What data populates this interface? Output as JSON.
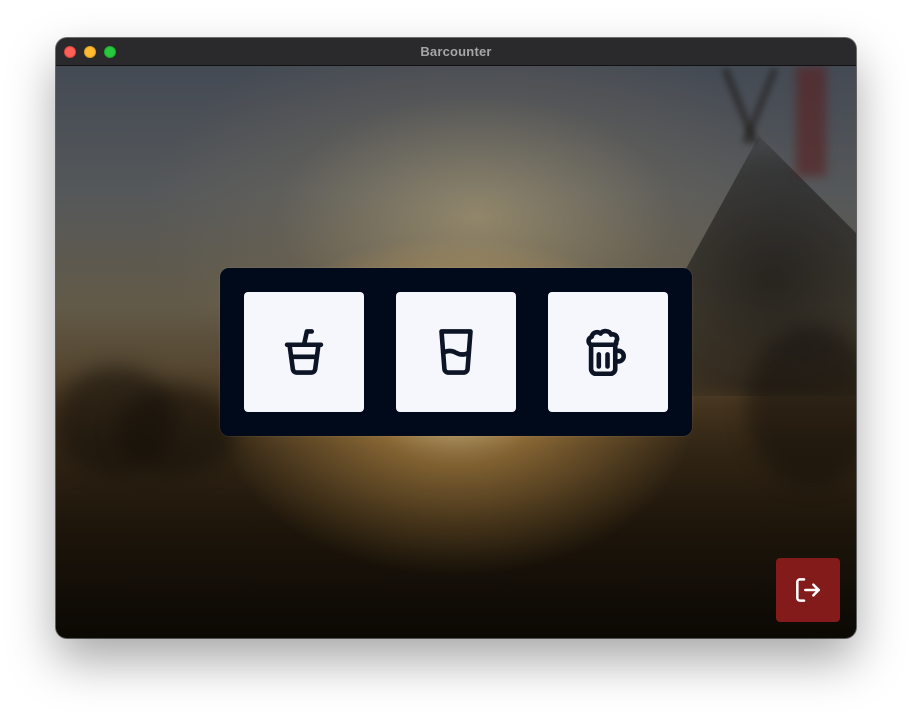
{
  "window": {
    "title": "Barcounter",
    "controls": {
      "close": "close",
      "minimize": "minimize",
      "maximize": "maximize"
    }
  },
  "drinks": [
    {
      "icon": "cup-with-straw-icon"
    },
    {
      "icon": "glass-of-water-icon"
    },
    {
      "icon": "beer-mug-icon"
    }
  ],
  "logout": {
    "icon": "logout-icon"
  },
  "colors": {
    "tray_background": "#000a1a",
    "button_background": "#f5f7fc",
    "icon_stroke": "#0c1425",
    "logout_background": "#831b1b",
    "logout_icon": "#ffffff"
  }
}
